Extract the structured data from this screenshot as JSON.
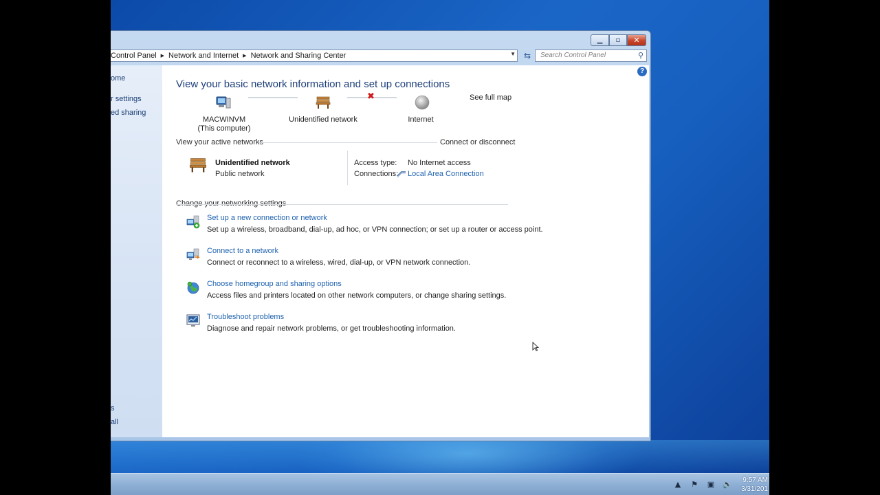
{
  "breadcrumb": [
    "Control Panel",
    "Network and Internet",
    "Network and Sharing Center"
  ],
  "search": {
    "placeholder": "Search Control Panel"
  },
  "window_controls": {
    "minimize": "minimize-icon",
    "maximize": "maximize-icon",
    "close": "close-icon"
  },
  "nav": {
    "items": [
      "ome",
      "r settings",
      "ed sharing",
      "s",
      "all"
    ]
  },
  "main": {
    "title": "View your basic network information and set up connections",
    "see_full_map": "See full map",
    "map": {
      "computer_name": "MACWINVM",
      "computer_sub": "(This computer)",
      "network": "Unidentified network",
      "internet": "Internet"
    },
    "active_networks": {
      "heading": "View your active networks",
      "connect_link": "Connect or disconnect",
      "network_name": "Unidentified network",
      "network_type": "Public network",
      "access_type_label": "Access type:",
      "access_type_value": "No Internet access",
      "connections_label": "Connections:",
      "connections_value": "Local Area Connection"
    },
    "change_settings": {
      "heading": "Change your networking settings",
      "tasks": [
        {
          "title": "Set up a new connection or network",
          "desc": "Set up a wireless, broadband, dial-up, ad hoc, or VPN connection; or set up a router or access point."
        },
        {
          "title": "Connect to a network",
          "desc": "Connect or reconnect to a wireless, wired, dial-up, or VPN network connection."
        },
        {
          "title": "Choose homegroup and sharing options",
          "desc": "Access files and printers located on other network computers, or change sharing settings."
        },
        {
          "title": "Troubleshoot problems",
          "desc": "Diagnose and repair network problems, or get troubleshooting information."
        }
      ]
    }
  },
  "taskbar": {
    "time": "9:57 AM",
    "date": "3/31/201"
  },
  "colors": {
    "link": "#1e62b0",
    "title": "#1e3f7a",
    "error_x": "#d11a1a"
  }
}
